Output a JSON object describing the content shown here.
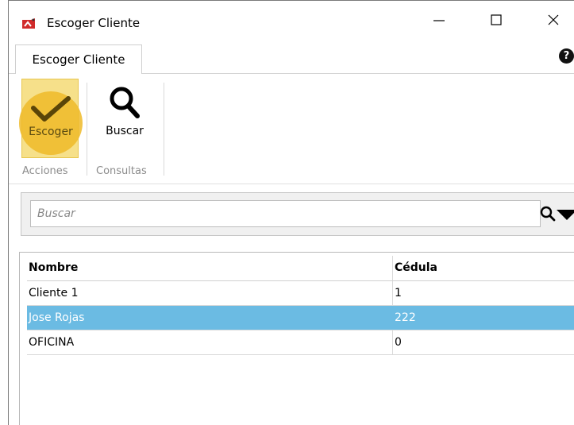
{
  "window": {
    "title": "Escoger Cliente",
    "controls": {
      "minimize": "—",
      "maximize": "☐",
      "close": "✕"
    }
  },
  "ribbon": {
    "tab_active": "Escoger Cliente",
    "help_icon": "?",
    "buttons": {
      "escoger": "Escoger",
      "buscar": "Buscar"
    },
    "groups": {
      "acciones": "Acciones",
      "consultas": "Consultas"
    },
    "highlight_color": "#efba28"
  },
  "search": {
    "placeholder": "Buscar"
  },
  "table": {
    "columns": [
      "Nombre",
      "Cédula"
    ],
    "rows": [
      {
        "nombre": "Cliente 1",
        "cedula": "1",
        "selected": false
      },
      {
        "nombre": "Jose Rojas",
        "cedula": "222",
        "selected": true
      },
      {
        "nombre": "OFICINA",
        "cedula": "0",
        "selected": false
      }
    ],
    "selection_color": "#6bbbe3"
  }
}
